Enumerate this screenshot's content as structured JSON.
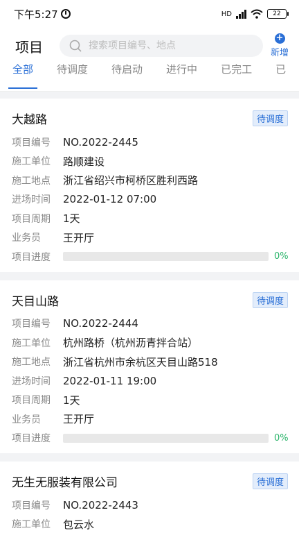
{
  "status_bar": {
    "time": "下午5:27",
    "network": "HD",
    "battery": "22"
  },
  "header": {
    "title": "项目",
    "search_placeholder": "搜索项目编号、地点",
    "add_label": "新增"
  },
  "tabs": [
    "全部",
    "待调度",
    "待启动",
    "进行中",
    "已完工",
    "已"
  ],
  "labels": {
    "code": "项目编号",
    "unit": "施工单位",
    "site": "施工地点",
    "entry": "进场时间",
    "period": "项目周期",
    "sales": "业务员",
    "progress": "项目进度"
  },
  "projects": [
    {
      "name": "大越路",
      "status": "待调度",
      "code": "NO.2022-2445",
      "unit": "路顺建设",
      "site": "浙江省绍兴市柯桥区胜利西路",
      "entry": "2022-01-12 07:00",
      "period": "1天",
      "sales": "王开厅",
      "progress_percent": 0,
      "progress_label": "0%"
    },
    {
      "name": "天目山路",
      "status": "待调度",
      "code": "NO.2022-2444",
      "unit": "杭州路桥（杭州沥青拌合站）",
      "site": "浙江省杭州市余杭区天目山路518",
      "entry": "2022-01-11 19:00",
      "period": "1天",
      "sales": "王开厅",
      "progress_percent": 0,
      "progress_label": "0%"
    },
    {
      "name": "无生无服装有限公司",
      "status": "待调度",
      "code": "NO.2022-2443",
      "unit": "包云水"
    }
  ],
  "colors": {
    "accent": "#2a6fd6",
    "progress": "#2ab46a"
  }
}
